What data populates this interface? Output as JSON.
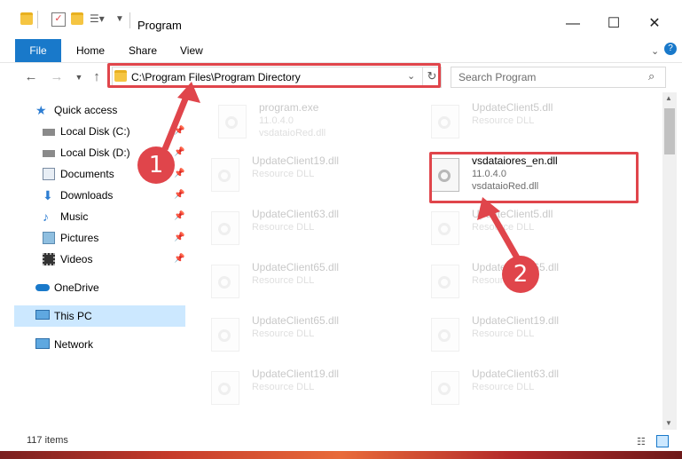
{
  "window": {
    "title": "Program",
    "controls": {
      "minimize": "—",
      "maximize": "☐",
      "close": "✕"
    }
  },
  "ribbon": {
    "tabs": [
      "File",
      "Home",
      "Share",
      "View"
    ]
  },
  "nav": {
    "address": "C:\\Program Files\\Program Directory",
    "search_placeholder": "Search Program"
  },
  "sidebar": {
    "items": [
      {
        "label": "Quick access",
        "icon": "star-icon"
      },
      {
        "label": "Local Disk (C:)",
        "icon": "drive-icon",
        "pinned": true
      },
      {
        "label": "Local Disk (D:)",
        "icon": "drive-icon",
        "pinned": true
      },
      {
        "label": "Documents",
        "icon": "documents-icon",
        "pinned": true
      },
      {
        "label": "Downloads",
        "icon": "download-icon",
        "pinned": true
      },
      {
        "label": "Music",
        "icon": "music-icon",
        "pinned": true
      },
      {
        "label": "Pictures",
        "icon": "pictures-icon",
        "pinned": true
      },
      {
        "label": "Videos",
        "icon": "videos-icon",
        "pinned": true
      },
      {
        "label": "OneDrive",
        "icon": "cloud-icon"
      },
      {
        "label": "This PC",
        "icon": "computer-icon"
      },
      {
        "label": "Network",
        "icon": "network-icon"
      }
    ]
  },
  "files": [
    {
      "name": "program.exe",
      "line2": "11.0.4.0",
      "line3": "vsdataioRed.dll",
      "faded": true
    },
    {
      "name": "UpdateClient5.dll",
      "line2": "Resource DLL",
      "faded": true
    },
    {
      "name": "UpdateClient19.dll",
      "line2": "Resource DLL",
      "faded": true
    },
    {
      "name": "vsdataiores_en.dll",
      "line2": "11.0.4.0",
      "line3": "vsdataioRed.dll",
      "faded": false
    },
    {
      "name": "UpdateClient63.dll",
      "line2": "Resource DLL",
      "faded": true
    },
    {
      "name": "UpdateClient5.dll",
      "line2": "Resource DLL",
      "faded": true
    },
    {
      "name": "UpdateClient65.dll",
      "line2": "Resource DLL",
      "faded": true
    },
    {
      "name": "UpdateClient65.dll",
      "line2": "Resource DLL",
      "faded": true
    },
    {
      "name": "UpdateClient65.dll",
      "line2": "Resource DLL",
      "faded": true
    },
    {
      "name": "UpdateClient19.dll",
      "line2": "Resource DLL",
      "faded": true
    },
    {
      "name": "UpdateClient19.dll",
      "line2": "Resource DLL",
      "faded": true
    },
    {
      "name": "UpdateClient63.dll",
      "line2": "Resource DLL",
      "faded": true
    }
  ],
  "markers": [
    "1",
    "2"
  ],
  "status": {
    "count": "117 items"
  },
  "colors": {
    "accent": "#1979ca",
    "highlight": "#e0454b",
    "selection": "#cce8ff"
  }
}
